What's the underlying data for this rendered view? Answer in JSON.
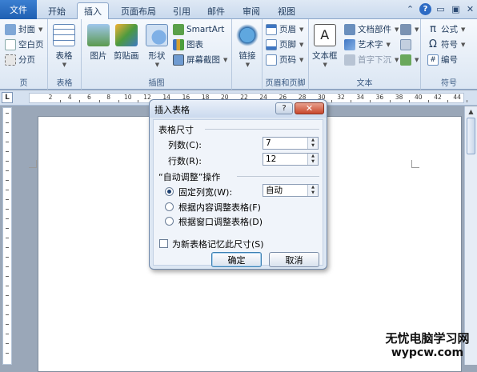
{
  "tabs": {
    "file": "文件",
    "items": [
      "开始",
      "插入",
      "页面布局",
      "引用",
      "邮件",
      "审阅",
      "视图"
    ],
    "active": "插入"
  },
  "ribbon": {
    "pages": {
      "label": "页",
      "cover": "封面",
      "blank": "空白页",
      "break": "分页"
    },
    "tables": {
      "label": "表格",
      "table": "表格"
    },
    "illustrations": {
      "label": "插图",
      "picture": "图片",
      "clipart": "剪贴画",
      "shapes": "形状",
      "smartart": "SmartArt",
      "chart": "图表",
      "screenshot": "屏幕截图"
    },
    "links": {
      "link": "链接"
    },
    "header_footer": {
      "label": "页眉和页脚",
      "header": "页眉",
      "footer": "页脚",
      "page_number": "页码"
    },
    "text": {
      "label": "文本",
      "textbox": "文本框",
      "quickparts": "文档部件",
      "wordart": "艺术字",
      "dropcap": "首字下沉"
    },
    "symbols": {
      "label": "符号",
      "equation": "公式",
      "symbol": "符号",
      "number": "编号"
    }
  },
  "ruler": {
    "numbers": [
      "2",
      "4",
      "6",
      "8",
      "10",
      "12",
      "14",
      "16",
      "18",
      "20",
      "22",
      "24",
      "26",
      "28",
      "30",
      "32",
      "34",
      "36",
      "38",
      "40",
      "42",
      "44"
    ]
  },
  "dialog": {
    "title": "插入表格",
    "help_label": "?",
    "close_label": "✕",
    "size_section": "表格尺寸",
    "columns_label": "列数(C):",
    "columns_value": "7",
    "rows_label": "行数(R):",
    "rows_value": "12",
    "autofit_section": "“自动调整”操作",
    "fixed_width_label": "固定列宽(W):",
    "fixed_width_value": "自动",
    "fit_contents_label": "根据内容调整表格(F)",
    "fit_window_label": "根据窗口调整表格(D)",
    "remember_label": "为新表格记忆此尺寸(S)",
    "ok_label": "确定",
    "cancel_label": "取消"
  },
  "watermark": {
    "line1": "无忧电脑学习网",
    "line2": "wypcw.com"
  },
  "colors": {
    "file_tab": "#2a6cc4",
    "ribbon_bg": "#dbe6f3",
    "dialog_close": "#c8472c"
  }
}
